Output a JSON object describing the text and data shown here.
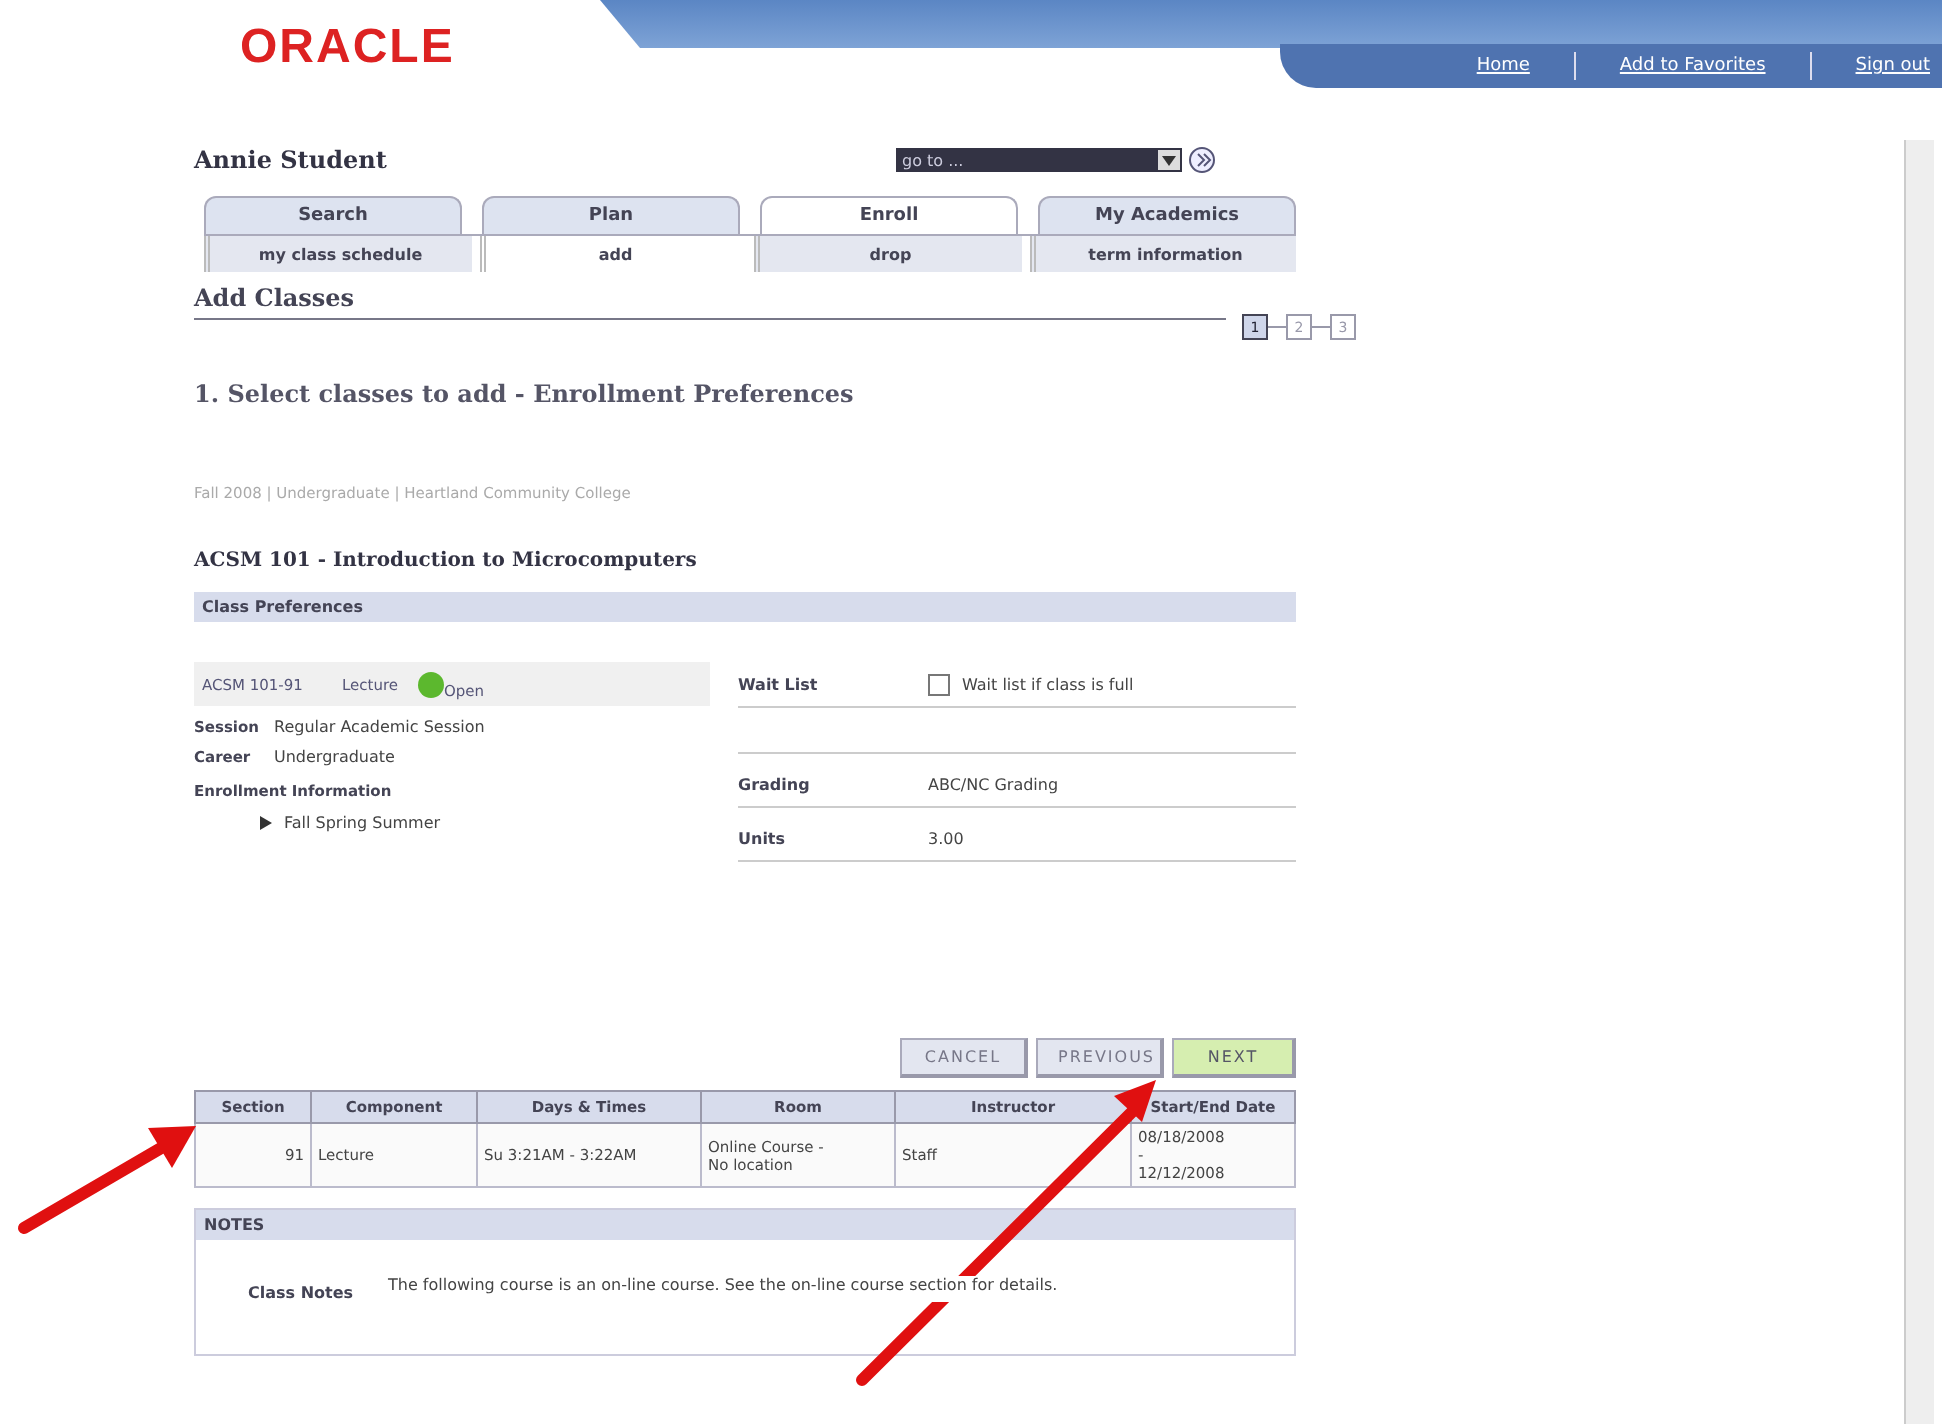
{
  "header": {
    "logo": "ORACLE",
    "links": [
      "Home",
      "Add to Favorites",
      "Sign out"
    ]
  },
  "user": {
    "name": "Annie Student",
    "goto_placeholder": "go to ..."
  },
  "tabs": [
    {
      "label": "Search",
      "selected": false
    },
    {
      "label": "Plan",
      "selected": false
    },
    {
      "label": "Enroll",
      "selected": true
    },
    {
      "label": "My Academics",
      "selected": false
    }
  ],
  "subtabs": [
    {
      "label": "my class schedule",
      "selected": false
    },
    {
      "label": "add",
      "selected": true
    },
    {
      "label": "drop",
      "selected": false
    },
    {
      "label": "term information",
      "selected": false
    }
  ],
  "page_title": "Add Classes",
  "steps": [
    {
      "label": "1",
      "selected": true
    },
    {
      "label": "2",
      "selected": false
    },
    {
      "label": "3",
      "selected": false
    }
  ],
  "step_title": "1.  Select classes to add - Enrollment Preferences",
  "breadcrumb": "Fall 2008 | Undergraduate | Heartland Community College",
  "course_title": "ACSM  101 - Introduction to Microcomputers",
  "preferences": {
    "header": "Class Preferences",
    "class_id": "ACSM 101-91",
    "component": "Lecture",
    "status": {
      "label": "Open",
      "color": "#5cb82e"
    },
    "details": [
      {
        "label": "Session",
        "value": "Regular Academic Session"
      },
      {
        "label": "Career",
        "value": "Undergraduate"
      }
    ],
    "enrollment_label": "Enrollment Information",
    "enrollment_value": "Fall Spring Summer",
    "wait_list_label": "Wait List",
    "wait_list_option": "Wait list if class is full",
    "wait_list_checked": false,
    "grading_label": "Grading",
    "grading_value": "ABC/NC Grading",
    "units_label": "Units",
    "units_value": "3.00"
  },
  "buttons": [
    {
      "label": "CANCEL",
      "kind": "plain"
    },
    {
      "label": "PREVIOUS",
      "kind": "plain"
    },
    {
      "label": "NEXT",
      "kind": "primary"
    }
  ],
  "table": {
    "columns": [
      "Section",
      "Component",
      "Days & Times",
      "Room",
      "Instructor",
      "Start/End Date"
    ],
    "rows": [
      [
        "91",
        "Lecture",
        "Su 3:21AM - 3:22AM",
        "Online Course - No location",
        "Staff",
        "08/18/2008 - 12/12/2008"
      ]
    ]
  },
  "notes": {
    "header": "NOTES",
    "label": "Class Notes",
    "text": "The following course is an on-line course. See the on-line course section for details."
  }
}
